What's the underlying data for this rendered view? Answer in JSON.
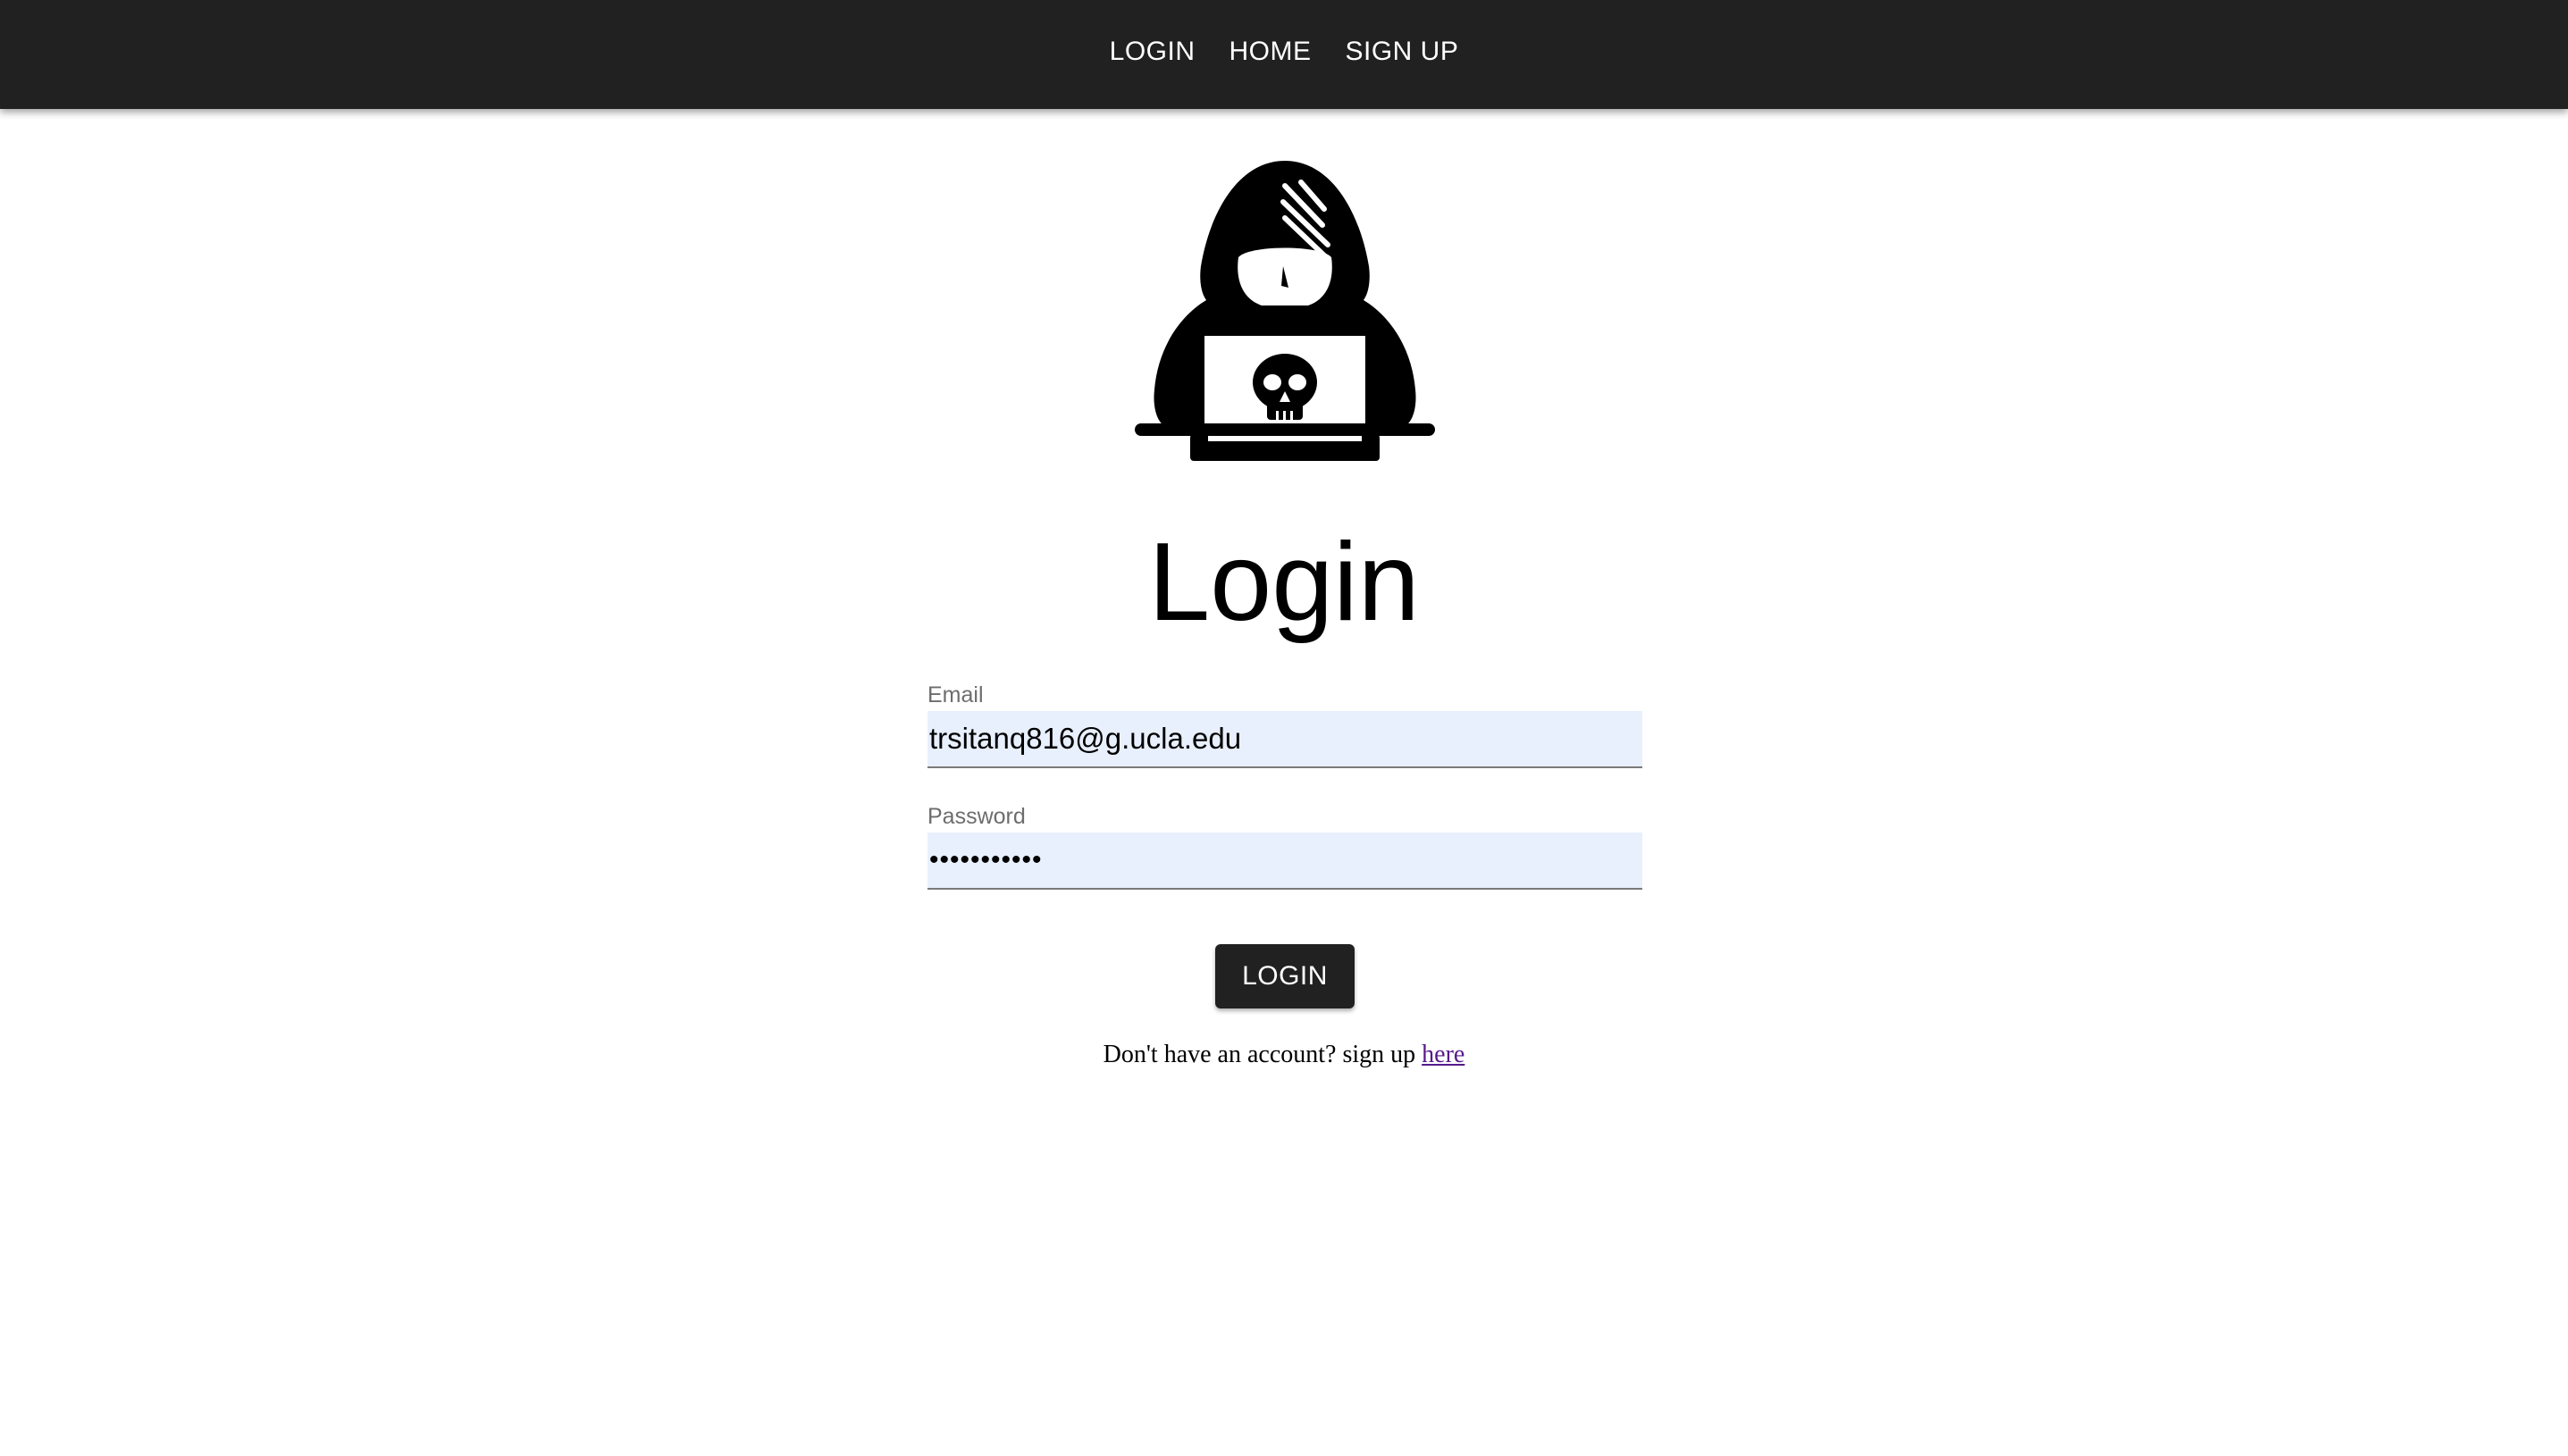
{
  "nav": {
    "items": [
      {
        "label": "LOGIN"
      },
      {
        "label": "HOME"
      },
      {
        "label": "SIGN UP"
      }
    ]
  },
  "logo": {
    "icon": "hooded-hacker-skull-laptop-icon"
  },
  "page": {
    "title": "Login"
  },
  "form": {
    "email": {
      "label": "Email",
      "value": "trsitanq816@g.ucla.edu"
    },
    "password": {
      "label": "Password",
      "value": "•••••••••••"
    },
    "submit_label": "LOGIN"
  },
  "signup": {
    "prompt": "Don't have an account? sign up ",
    "link_text": "here"
  },
  "colors": {
    "navbar_bg": "#212121",
    "input_bg": "#e8effd",
    "link_visited": "#551a8b"
  }
}
